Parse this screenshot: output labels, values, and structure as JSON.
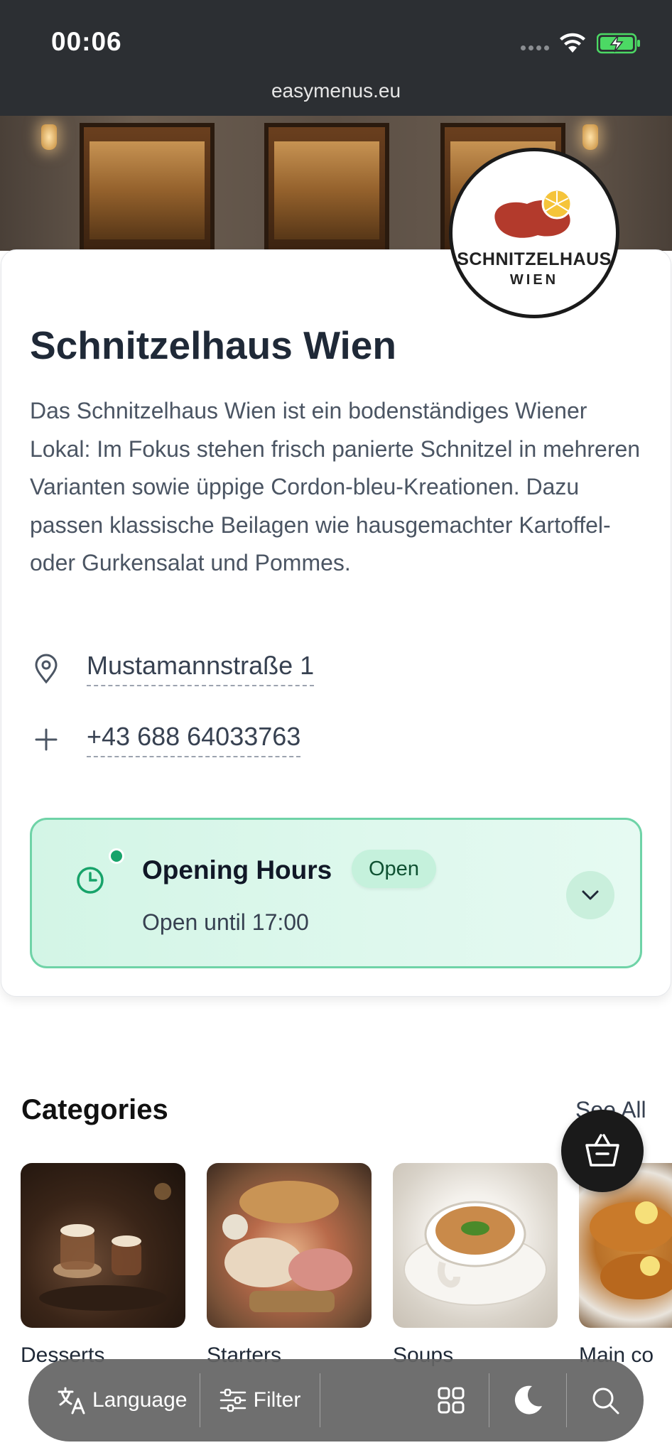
{
  "status_bar": {
    "time": "00:06",
    "url": "easymenus.eu",
    "icons": [
      "cellular-signal-icon",
      "wifi-icon",
      "battery-charging-icon"
    ],
    "battery_color": "#4cd964"
  },
  "restaurant": {
    "name": "Schnitzelhaus Wien",
    "logo_name": "SCHNITZELHAUS",
    "logo_sub": "WIEN",
    "description": "Das Schnitzelhaus Wien ist ein bodenständiges Wiener Lokal: Im Fokus stehen frisch panierte Schnitzel in mehreren Varianten sowie üppige Cordon-bleu-Kreationen.  Dazu passen klassische Beilagen wie hausgemachter Kartoffel- oder Gurkensalat und Pommes.",
    "address": "Mustamannstraße 1",
    "phone": "+43 688 64033763"
  },
  "opening_hours": {
    "title": "Opening Hours",
    "badge": "Open",
    "subtitle": "Open until 17:00",
    "accent": "#17a36a"
  },
  "categories": {
    "title": "Categories",
    "see_all": "See All",
    "items": [
      {
        "label": "Desserts"
      },
      {
        "label": "Starters"
      },
      {
        "label": "Soups"
      },
      {
        "label": "Main co"
      }
    ]
  },
  "toolbar": {
    "language_label": "Language",
    "filter_label": "Filter",
    "icons": [
      "translate-icon",
      "filter-sliders-icon",
      "grid-view-icon",
      "moon-icon",
      "search-icon"
    ]
  }
}
